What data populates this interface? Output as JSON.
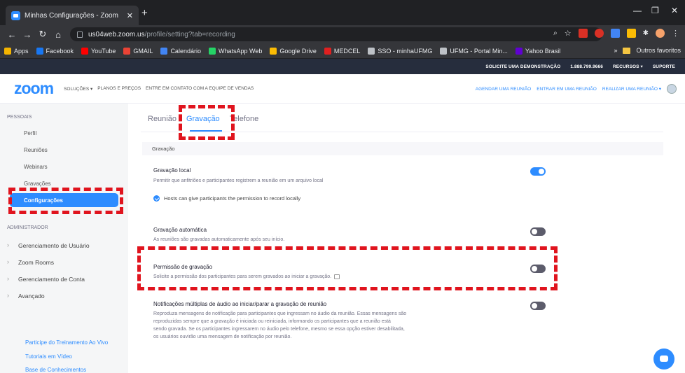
{
  "browser": {
    "tab_title": "Minhas Configurações - Zoom",
    "tab_close": "✕",
    "new_tab": "+",
    "url_host": "us04web.zoom.us",
    "url_path": "/profile/setting?tab=recording",
    "bookmarks": [
      {
        "label": "Apps",
        "color": "#f4b400"
      },
      {
        "label": "Facebook",
        "color": "#1877f2"
      },
      {
        "label": "YouTube",
        "color": "#ff0000"
      },
      {
        "label": "GMAIL",
        "color": "#ea4335"
      },
      {
        "label": "Calendário",
        "color": "#4285f4"
      },
      {
        "label": "WhatsApp Web",
        "color": "#25d366"
      },
      {
        "label": "Google Drive",
        "color": "#fbbc04"
      },
      {
        "label": "MEDCEL",
        "color": "#e02020"
      },
      {
        "label": "SSO - minhaUFMG",
        "color": "#bdc1c6"
      },
      {
        "label": "UFMG - Portal Min...",
        "color": "#bdc1c6"
      },
      {
        "label": "Yahoo Brasil",
        "color": "#6001d2"
      }
    ],
    "more": "»",
    "other_favorites": "Outros favoritos"
  },
  "promo": {
    "demo": "SOLICITE UMA DEMONSTRAÇÃO",
    "phone": "1.888.799.9666",
    "resources": "RECURSOS ▾",
    "support": "SUPORTE"
  },
  "header": {
    "logo": "zoom",
    "nav": [
      "SOLUÇÕES ▾",
      "PLANOS E PREÇOS",
      "ENTRE EM CONTATO COM A EQUIPE DE VENDAS"
    ],
    "schedule": "AGENDAR UMA REUNIÃO",
    "join": "ENTRAR EM UMA REUNIÃO",
    "host": "REALIZAR UMA REUNIÃO ▾"
  },
  "sidebar": {
    "personal_head": "PESSOAIS",
    "items": [
      "Perfil",
      "Reuniões",
      "Webinars",
      "Gravações"
    ],
    "active": "Configurações",
    "admin_head": "ADMINISTRADOR",
    "admin_items": [
      "Gerenciamento de Usuário",
      "Zoom Rooms",
      "Gerenciamento de Conta",
      "Avançado"
    ],
    "links": [
      "Participe do Treinamento Ao Vivo",
      "Tutoriais em Vídeo",
      "Base de Conhecimentos"
    ]
  },
  "main": {
    "tabs": [
      "Reunião",
      "Gravação",
      "Telefone"
    ],
    "section": "Gravação",
    "settings": [
      {
        "title": "Gravação local",
        "desc": "Permitir que anfitriões e participantes registrem a reunião em um arquivo local",
        "on": true
      },
      {
        "title": "Gravação automática",
        "desc": "As reuniões são gravadas automaticamente após seu início.",
        "on": false
      },
      {
        "title": "Permissão de gravação",
        "desc": "Solicite a permissão dos participantes para serem gravados ao iniciar a gravação.",
        "on": false
      },
      {
        "title": "Notificações múltiplas de áudio ao iniciar/parar a gravação de reunião",
        "desc_lines": [
          "Reproduza mensagens de notificação para participantes que ingressam no áudio da reunião. Essas mensagens são",
          "reproduzidas sempre que a gravação é iniciada ou reiniciada, informando os participantes que a reunião está",
          "sendo gravada. Se os participantes ingressarem no áudio pelo telefone, mesmo se essa opção estiver desabilitada,",
          "os usuários ouvirão uma mensagem de notificação por reunião."
        ],
        "on": false
      }
    ],
    "checkbox_label": "Hosts can give participants the permission to record locally"
  },
  "colors": {
    "accent": "#2d8cff",
    "annotation": "#e0141e"
  }
}
